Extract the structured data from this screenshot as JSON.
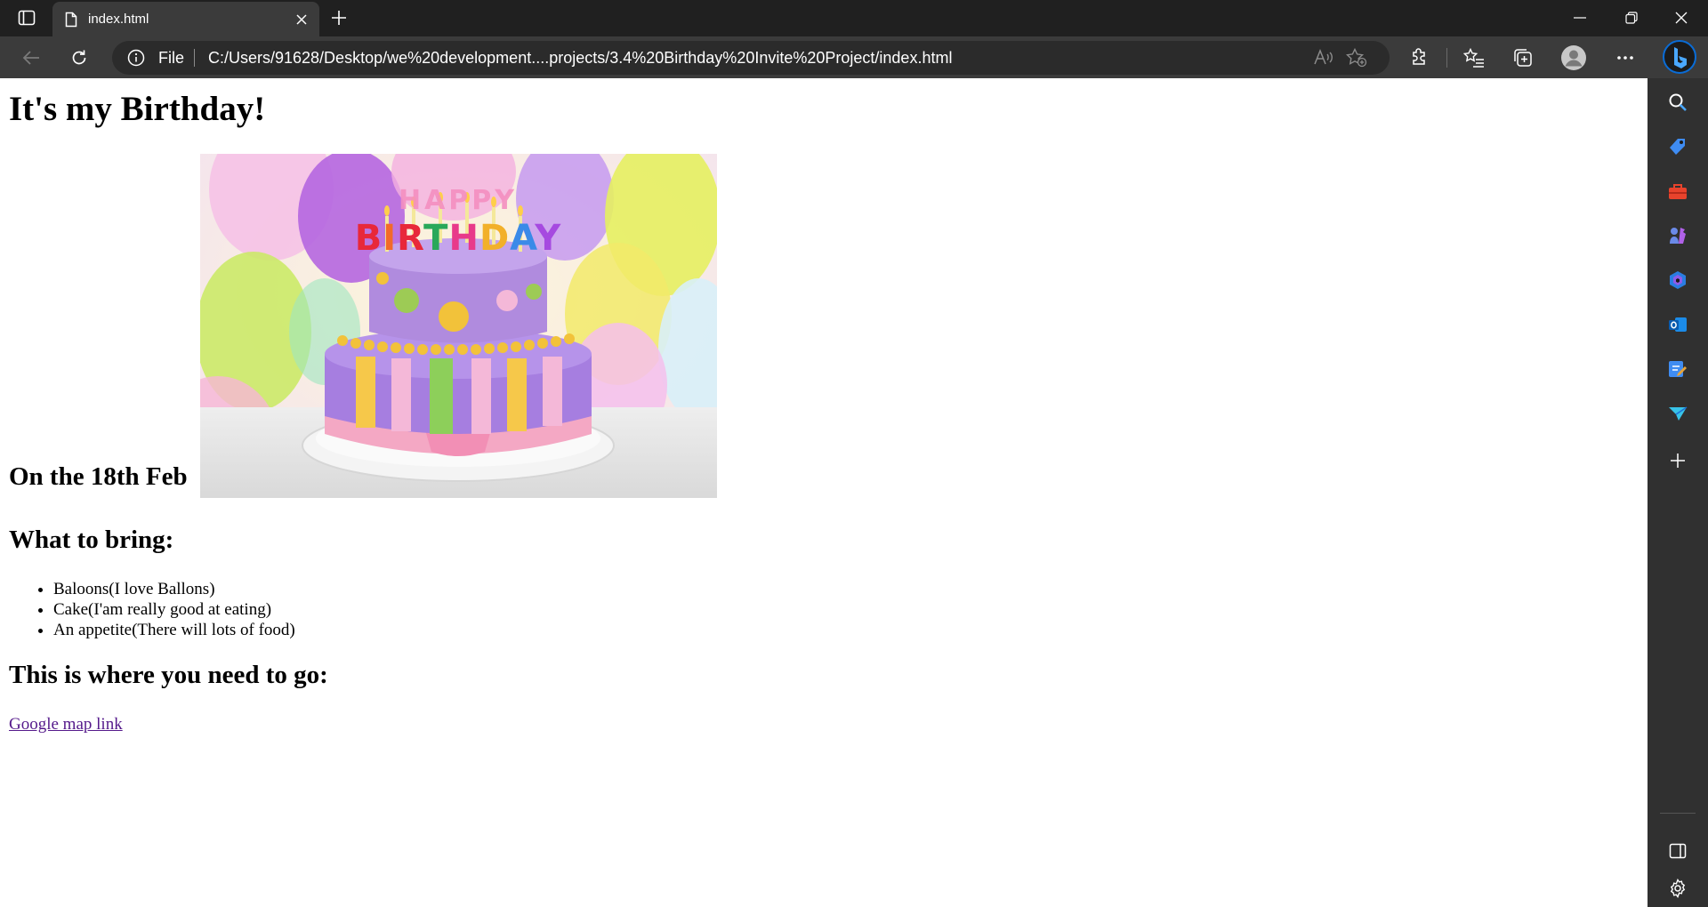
{
  "browser": {
    "tab": {
      "title": "index.html"
    },
    "address": {
      "scheme_label": "File",
      "url": "C:/Users/91628/Desktop/we%20development....projects/3.4%20Birthday%20Invite%20Project/index.html"
    },
    "accent_color": "#0a6cd6"
  },
  "page": {
    "heading": "It's my Birthday!",
    "date": "On the 18th Feb",
    "image_lettering": "HAPPY BIRTHDAY",
    "bring_heading": "What to bring:",
    "bring_items": [
      "Baloons(I love Ballons)",
      "Cake(I'am really good at eating)",
      "An appetite(There will lots of food)"
    ],
    "go_heading": "This is where you need to go:",
    "map_link": "Google map link",
    "link_color": "#551a8b"
  }
}
